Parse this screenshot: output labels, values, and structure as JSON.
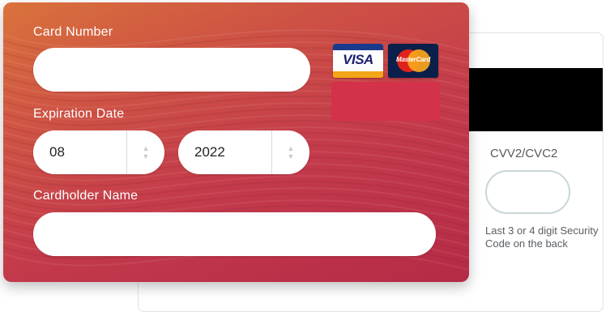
{
  "front": {
    "card_number_label": "Card Number",
    "card_number_value": "",
    "expiration_label": "Expiration Date",
    "month_value": "08",
    "year_value": "2022",
    "cardholder_label": "Cardholder Name",
    "cardholder_value": "",
    "visa_text": "VISA",
    "mastercard_text": "MasterCard"
  },
  "back": {
    "cvv_label": "CVV2/CVC2",
    "cvv_value": "",
    "cvv_hint": "Last 3 or 4 digit Security Code on the back"
  },
  "colors": {
    "card_start": "#d36a3d",
    "card_end": "#b52a46",
    "stripe": "#000000"
  }
}
